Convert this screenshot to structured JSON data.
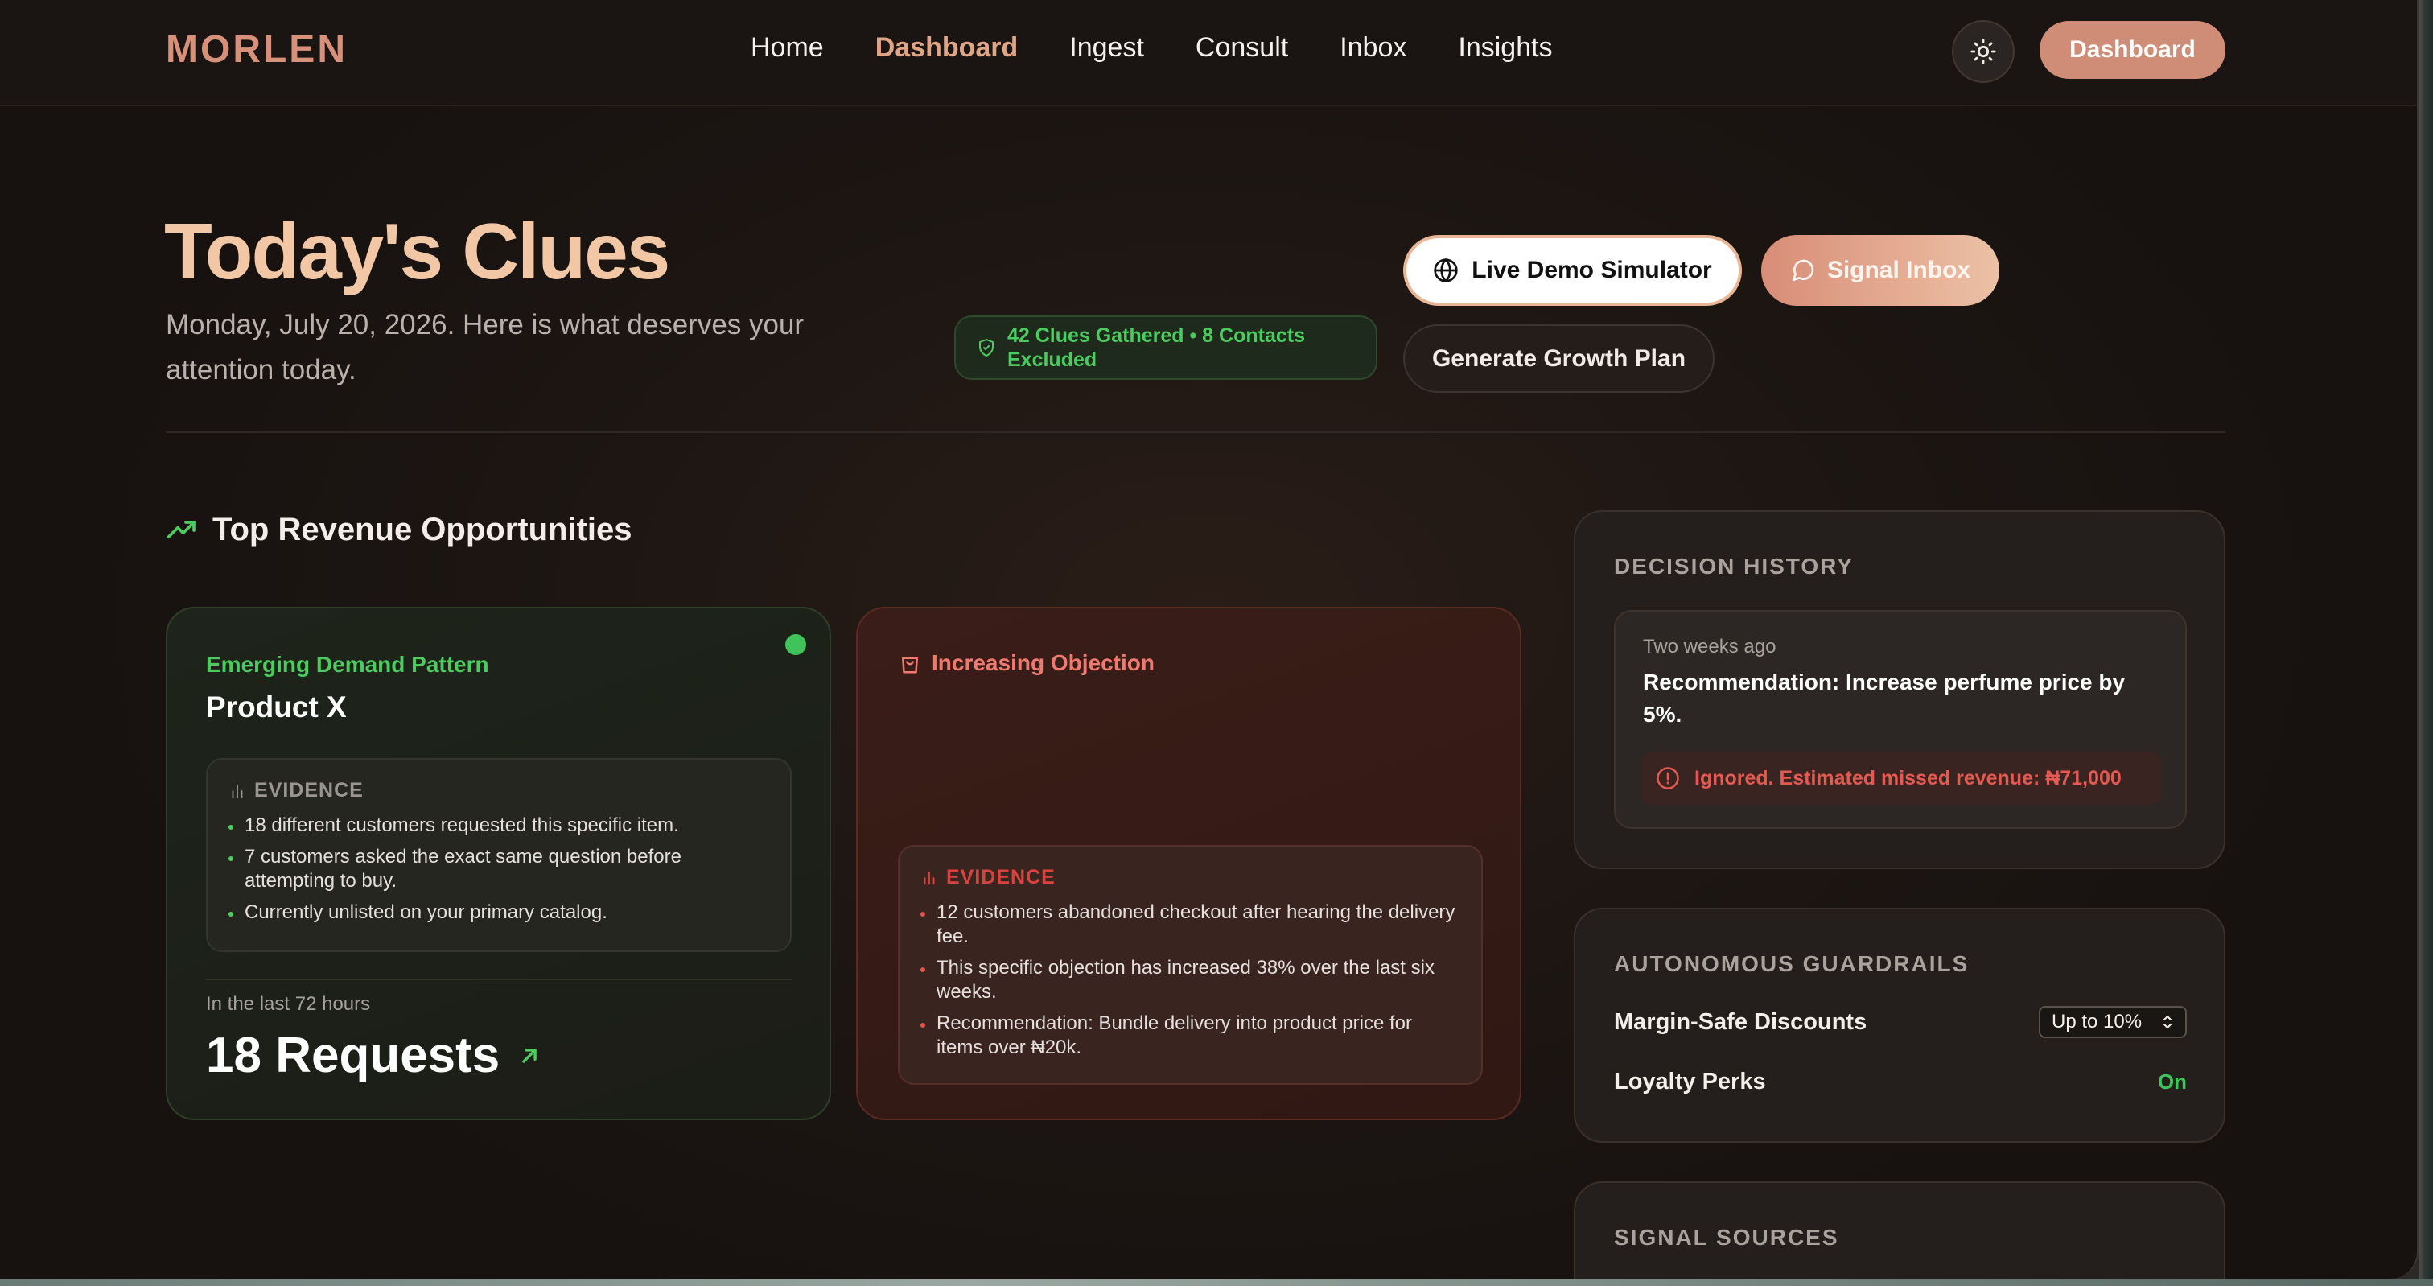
{
  "nav": {
    "logo": "MORLEN",
    "links": [
      "Home",
      "Dashboard",
      "Ingest",
      "Consult",
      "Inbox",
      "Insights"
    ],
    "active_link": "Dashboard",
    "theme_icon": "sun-icon",
    "cta_label": "Dashboard"
  },
  "hero": {
    "title": "Today's Clues",
    "subtitle": "Monday, July 20, 2026. Here is what deserves your attention today.",
    "badge": "42 Clues Gathered • 8 Contacts Excluded",
    "live_demo_label": "Live Demo Simulator",
    "signal_inbox_label": "Signal Inbox",
    "growth_plan_label": "Generate Growth Plan"
  },
  "opportunities": {
    "section_title": "Top Revenue Opportunities",
    "cards": [
      {
        "kicker": "Emerging Demand Pattern",
        "product": "Product X",
        "evidence_heading": "EVIDENCE",
        "evidence": [
          "18 different customers requested this specific item.",
          "7 customers asked the exact same question before attempting to buy.",
          "Currently unlisted on your primary catalog."
        ],
        "meta": "In the last 72 hours",
        "metric": "18 Requests"
      },
      {
        "kicker": "Increasing Objection",
        "evidence_heading": "EVIDENCE",
        "evidence": [
          "12 customers abandoned checkout after hearing the delivery fee.",
          "This specific objection has increased 38% over the last six weeks.",
          "Recommendation: Bundle delivery into product price for items over ₦20k."
        ]
      }
    ]
  },
  "decision_history": {
    "title": "DECISION HISTORY",
    "time": "Two weeks ago",
    "recommendation": "Recommendation: Increase perfume price by 5%.",
    "alert": "Ignored. Estimated missed revenue: ₦71,000"
  },
  "guardrails": {
    "title": "AUTONOMOUS GUARDRAILS",
    "discount_label": "Margin-Safe Discounts",
    "discount_value": "Up to 10%",
    "loyalty_label": "Loyalty Perks",
    "loyalty_value": "On"
  },
  "signal_sources": {
    "title": "SIGNAL SOURCES"
  },
  "colors": {
    "accent": "#cf8c76",
    "success": "#4ccb5f",
    "danger": "#ef7a70"
  }
}
